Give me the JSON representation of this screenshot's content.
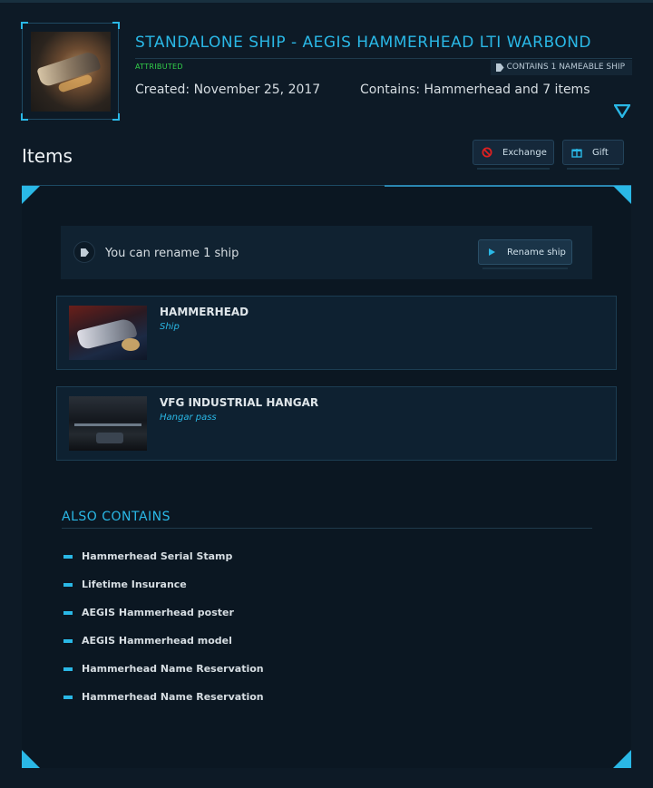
{
  "package": {
    "title": "STANDALONE SHIP - AEGIS HAMMERHEAD LTI WARBOND",
    "status": "ATTRIBUTED",
    "nameable_badge": "CONTAINS 1 NAMEABLE SHIP",
    "created": "Created: November 25, 2017",
    "contains": "Contains: Hammerhead and 7 items"
  },
  "items_section": {
    "heading": "Items",
    "exchange_label": "Exchange",
    "gift_label": "Gift"
  },
  "rename": {
    "text": "You can rename 1 ship",
    "button_label": "Rename ship"
  },
  "items": [
    {
      "name": "HAMMERHEAD",
      "type": "Ship"
    },
    {
      "name": "VFG INDUSTRIAL HANGAR",
      "type": "Hangar pass"
    }
  ],
  "also_contains": {
    "heading": "ALSO CONTAINS",
    "items": [
      "Hammerhead Serial Stamp",
      "Lifetime Insurance",
      "AEGIS Hammerhead poster",
      "AEGIS Hammerhead model",
      "Hammerhead Name Reservation",
      "Hammerhead Name Reservation"
    ]
  },
  "colors": {
    "accent": "#2ab8e6",
    "attributed": "#33d04a",
    "background": "#0d1a26",
    "exchange_icon": "#e02020"
  },
  "icons": [
    "tag-icon",
    "expand-chevron-icon",
    "exchange-forbidden-icon",
    "gift-icon",
    "play-icon"
  ]
}
